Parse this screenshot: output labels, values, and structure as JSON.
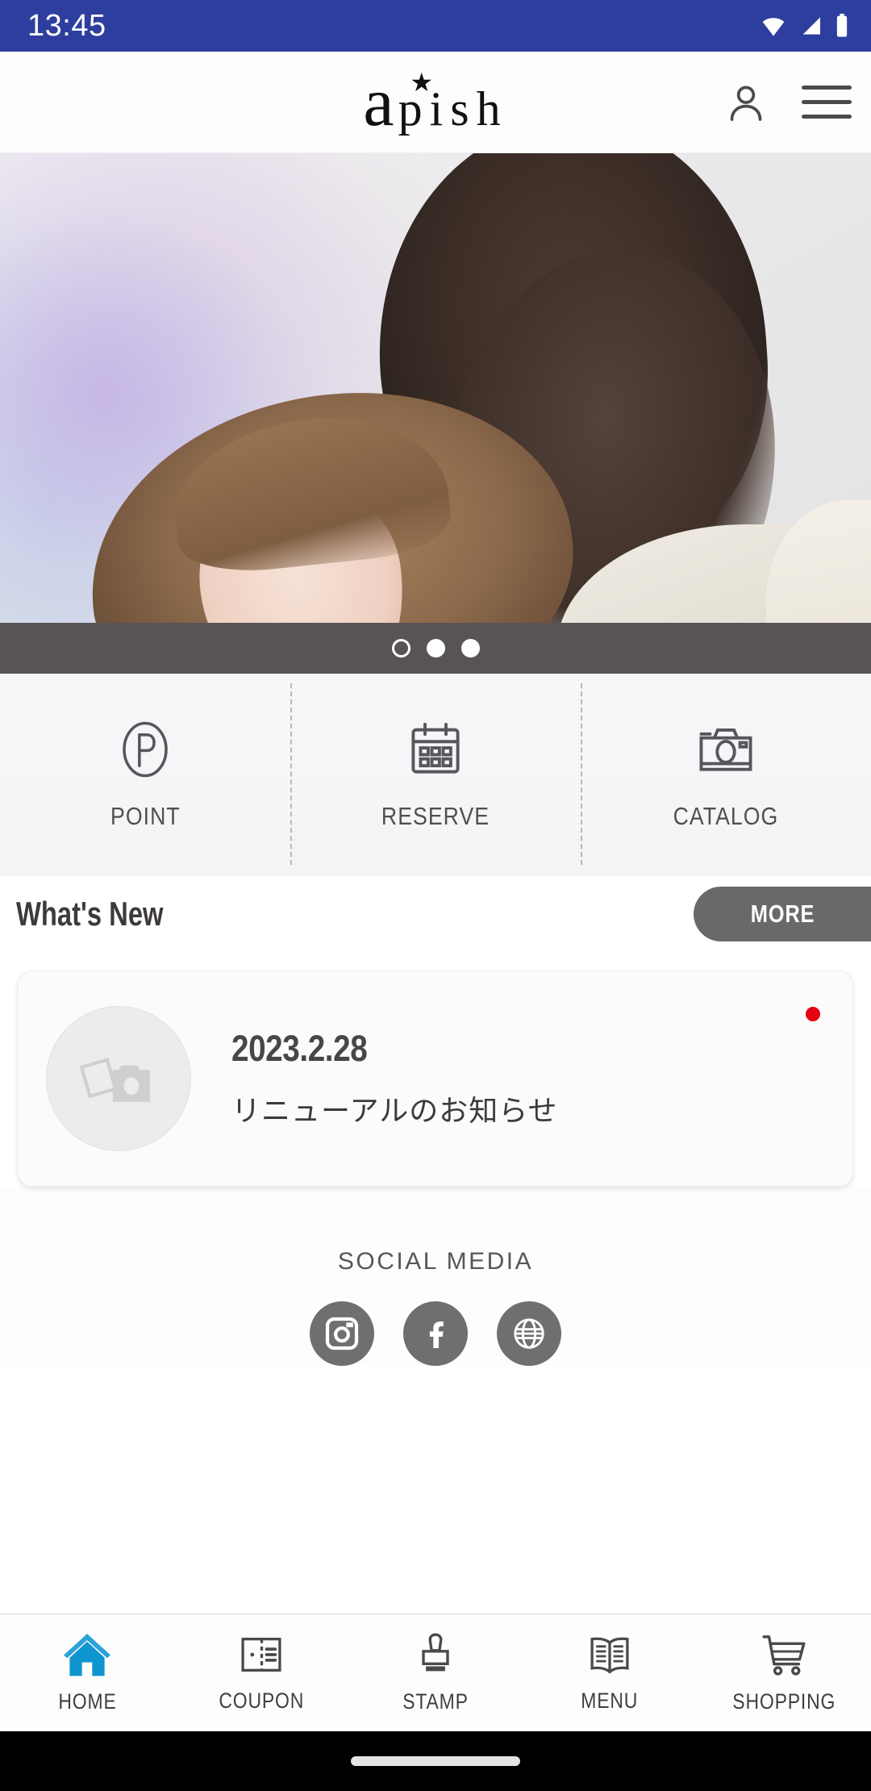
{
  "status_bar": {
    "time": "13:45",
    "icons": [
      "wifi-icon",
      "signal-icon",
      "battery-icon"
    ],
    "background": "#2e3e9e"
  },
  "header": {
    "logo_a": "a",
    "logo_star": "★",
    "logo_rest": "pish",
    "logo_full": "apish",
    "account_icon": "person-icon",
    "menu_icon": "hamburger-menu-icon"
  },
  "hero": {
    "alt": "two women with styled hair salon campaign photo",
    "slide_count": 3,
    "active_slide": 1,
    "dots": [
      {
        "filled": false
      },
      {
        "filled": true
      },
      {
        "filled": true
      }
    ],
    "dot_bar_color": "#585355"
  },
  "quick_actions": [
    {
      "label": "POINT",
      "icon": "point-p-circle-icon"
    },
    {
      "label": "RESERVE",
      "icon": "calendar-icon"
    },
    {
      "label": "CATALOG",
      "icon": "camera-icon"
    }
  ],
  "whats_new": {
    "title": "What's New",
    "more_label": "MORE",
    "more_color": "#6b6869",
    "items": [
      {
        "date": "2023.2.28",
        "text": "リニューアルのお知らせ",
        "thumb_icon": "photo-camera-placeholder-icon",
        "unread": true,
        "unread_color": "#e60012"
      }
    ]
  },
  "social_media": {
    "title": "SOCIAL MEDIA",
    "circle_color": "#706e71",
    "links": [
      {
        "name": "instagram",
        "icon": "instagram-icon"
      },
      {
        "name": "facebook",
        "icon": "facebook-icon"
      },
      {
        "name": "website",
        "icon": "globe-icon"
      }
    ]
  },
  "bottom_nav": {
    "active_color": "#1e9bd7",
    "items": [
      {
        "label": "HOME",
        "icon": "home-icon",
        "active": true
      },
      {
        "label": "COUPON",
        "icon": "coupon-ticket-icon",
        "active": false
      },
      {
        "label": "STAMP",
        "icon": "stamp-icon",
        "active": false
      },
      {
        "label": "MENU",
        "icon": "open-book-icon",
        "active": false
      },
      {
        "label": "SHOPPING",
        "icon": "shopping-cart-icon",
        "active": false
      }
    ]
  },
  "gesture_bar": {
    "handle": "home-gesture-pill"
  }
}
